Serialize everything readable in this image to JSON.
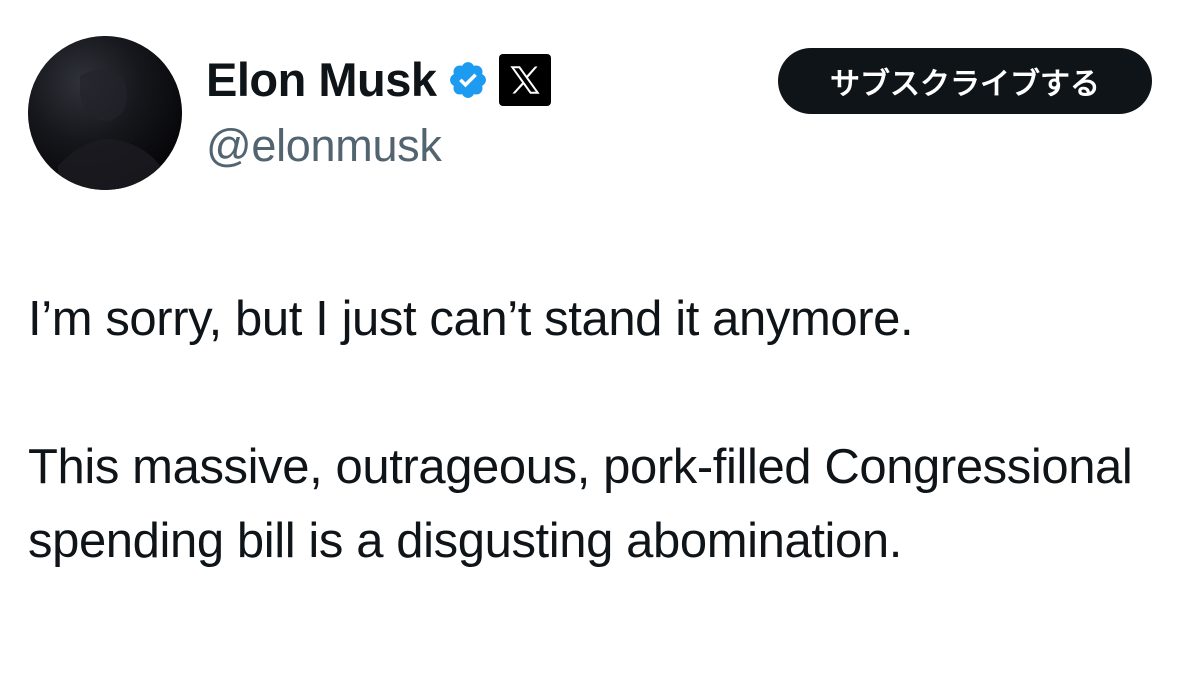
{
  "author": {
    "display_name": "Elon Musk",
    "handle": "@elonmusk",
    "verified_color": "#1d9bf0",
    "avatar_icon": "avatar-dark-portrait"
  },
  "actions": {
    "subscribe_label": "サブスクライブする"
  },
  "tweet": {
    "paragraphs": [
      "I’m sorry, but I just can’t stand it anymore.",
      "This massive, outrageous, pork-filled Congressional spending bill is a disgusting abomination."
    ]
  },
  "colors": {
    "text_primary": "#0f1419",
    "text_secondary": "#536471",
    "button_bg": "#0f1419",
    "button_text": "#ffffff"
  }
}
